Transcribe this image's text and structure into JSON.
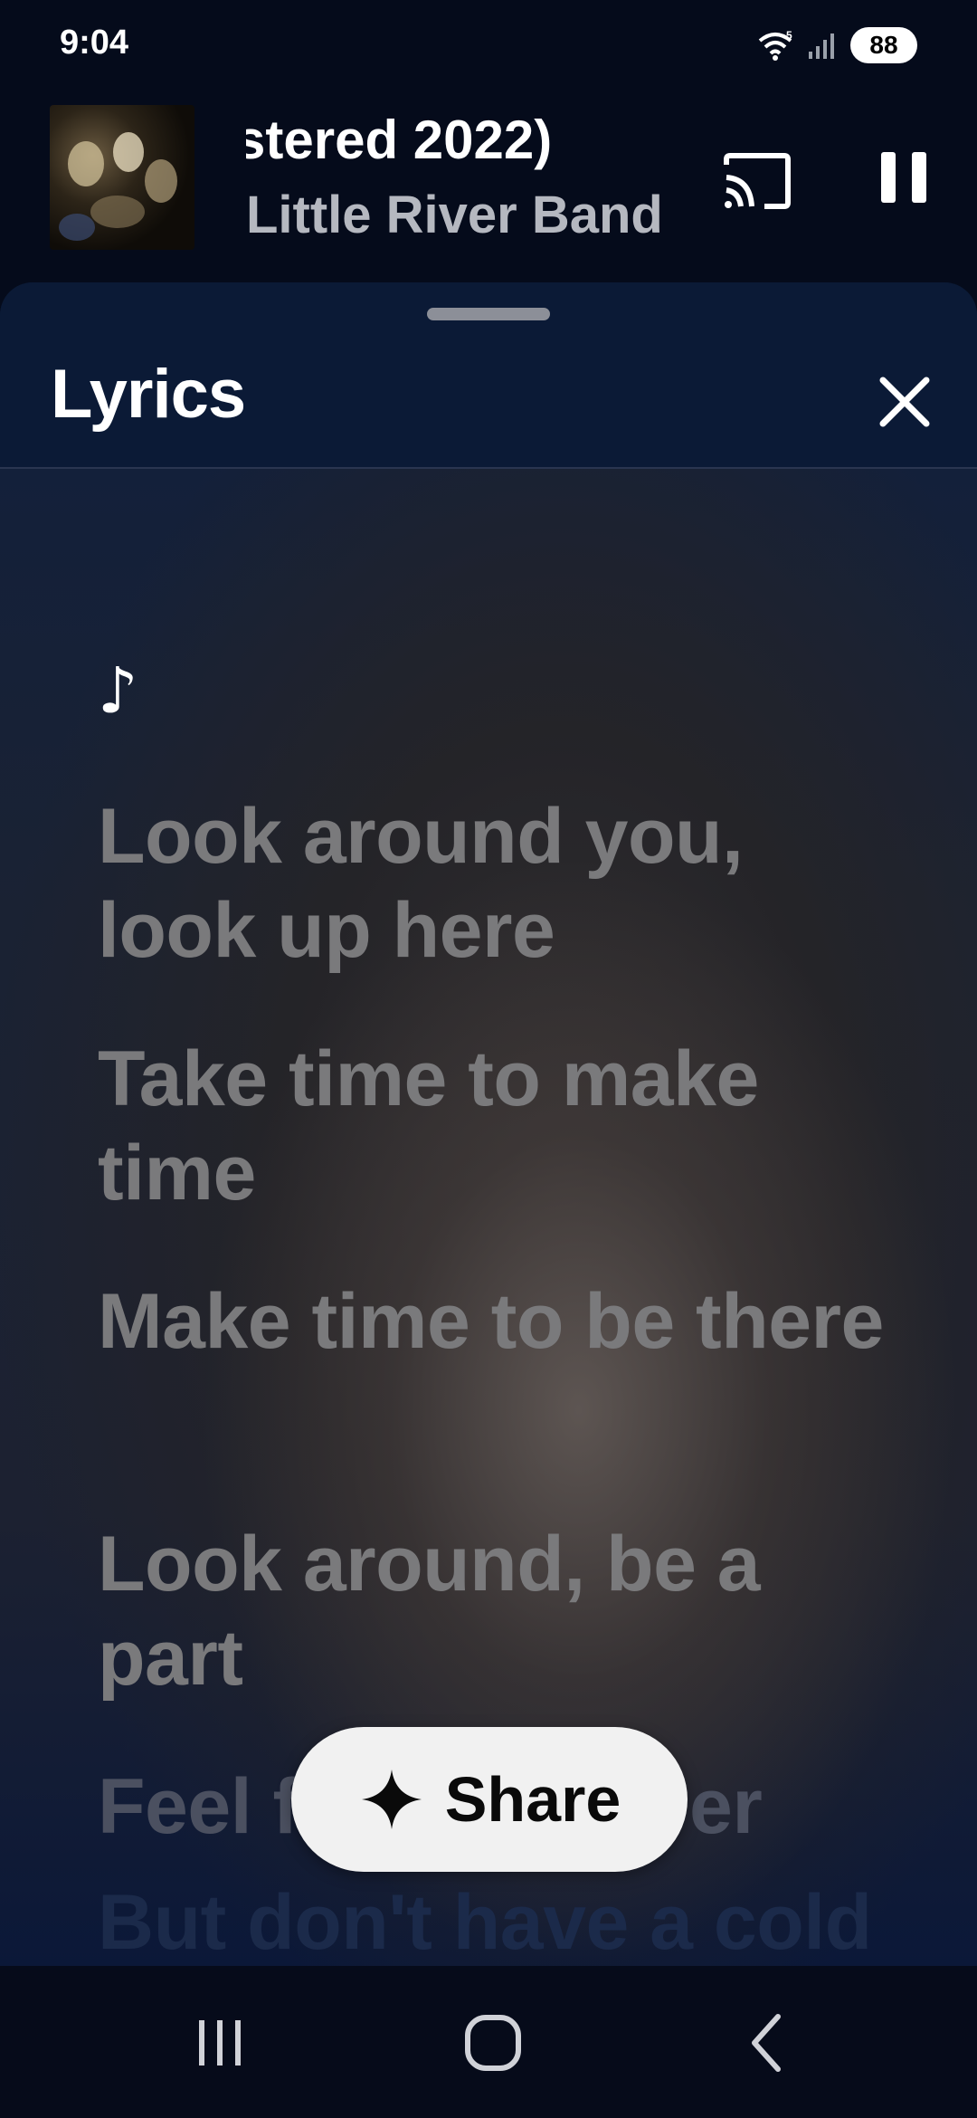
{
  "status_bar": {
    "time": "9:04",
    "battery": "88",
    "icons": [
      "wifi-icon",
      "signal-icon",
      "battery-icon"
    ]
  },
  "mini_player": {
    "title": "stered 2022)",
    "artist": "Little River Band",
    "cast_icon": "cast-icon",
    "pause_icon": "pause-icon"
  },
  "lyrics_sheet": {
    "title": "Lyrics",
    "close_icon": "close-icon",
    "note": "♪",
    "lines": [
      "Look around you, look up here",
      "Take time to make time",
      "Make time to be there",
      "Look around, be a part",
      "Feel f",
      "er",
      "But don't have a cold"
    ]
  },
  "share_button": {
    "label": "Share",
    "icon": "sparkle-icon"
  },
  "nav_bar": {
    "icons": [
      "recents-icon",
      "home-icon",
      "back-icon"
    ]
  },
  "colors": {
    "background": "#050b1b",
    "header": "#0b1a36",
    "lyric_text": "#7a7a7c",
    "share_bg": "#f1f1f1"
  }
}
